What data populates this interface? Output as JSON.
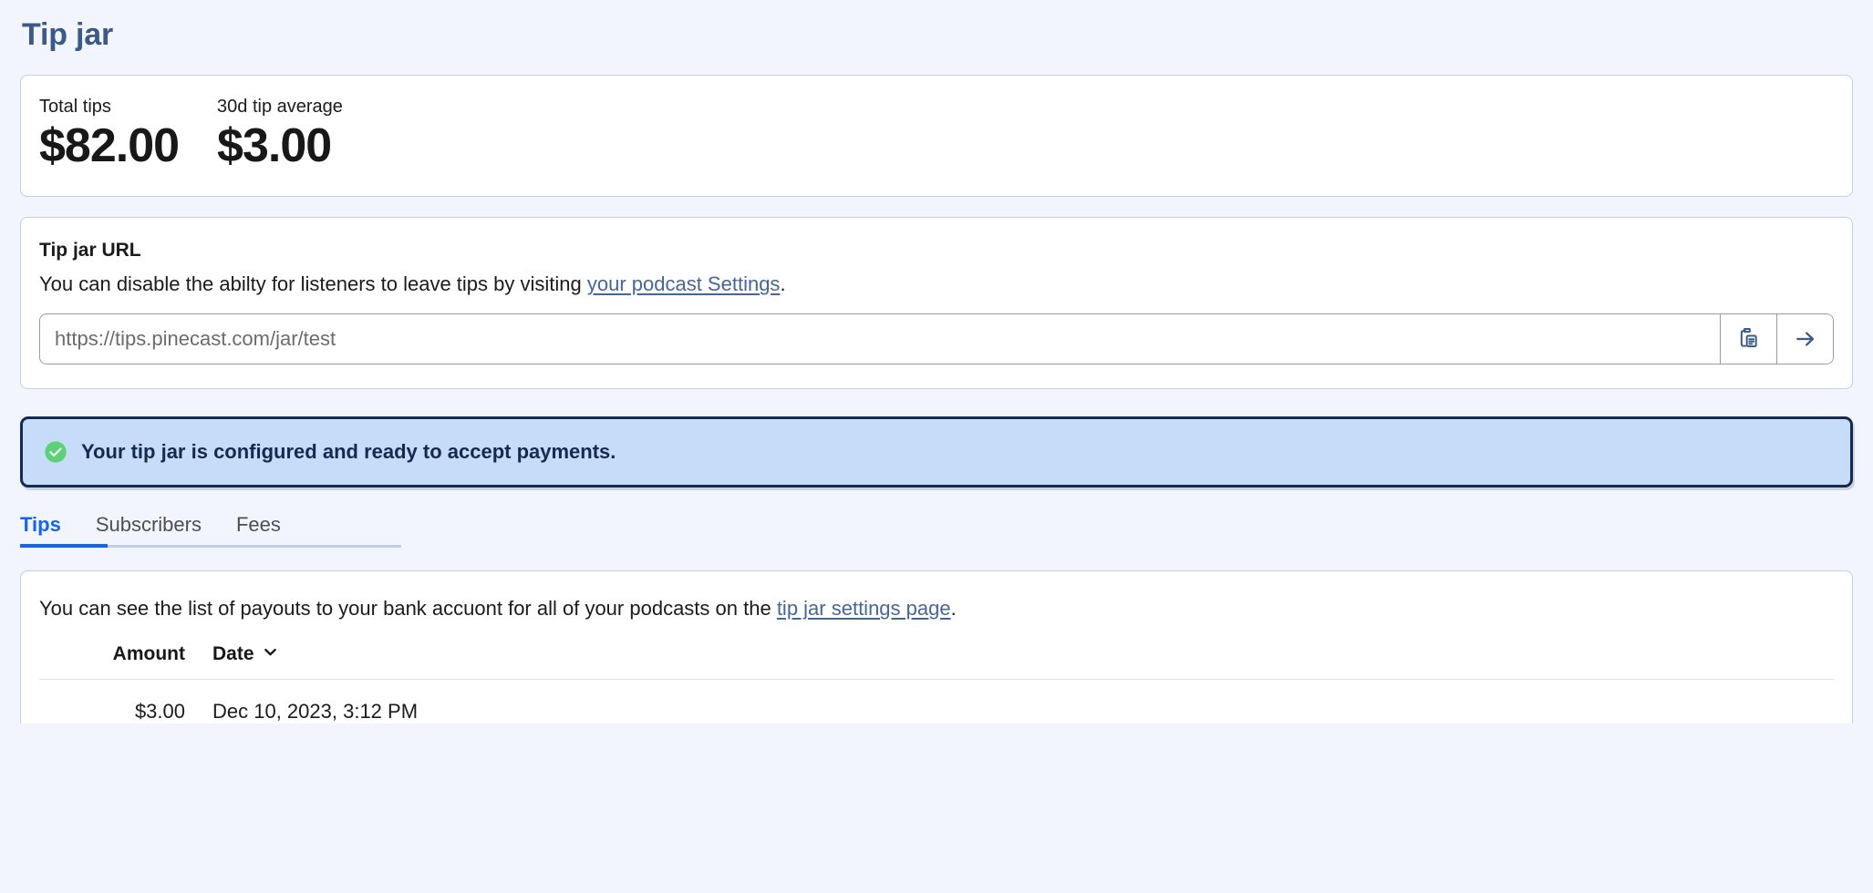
{
  "page": {
    "title": "Tip jar"
  },
  "stats": {
    "items": [
      {
        "label": "Total tips",
        "value": "$82.00"
      },
      {
        "label": "30d tip average",
        "value": "$3.00"
      }
    ]
  },
  "url_card": {
    "title": "Tip jar URL",
    "desc_before": "You can disable the abilty for listeners to leave tips by visiting ",
    "desc_link": "your podcast Settings",
    "desc_after": ".",
    "input_value": "https://tips.pinecast.com/jar/test",
    "input_placeholder": "https://tips.pinecast.com/jar/test",
    "copy_icon": "clipboard-copy-icon",
    "go_icon": "arrow-right-icon"
  },
  "banner": {
    "icon": "check-circle-icon",
    "text": "Your tip jar is configured and ready to accept payments.",
    "bg_color": "#c7dcf8",
    "border_color": "#122a54",
    "icon_color": "#5ed07a"
  },
  "tabs": {
    "items": [
      {
        "label": "Tips",
        "active": true
      },
      {
        "label": "Subscribers",
        "active": false
      },
      {
        "label": "Fees",
        "active": false
      }
    ],
    "active_color": "#1464ef"
  },
  "payouts": {
    "desc_before": "You can see the list of payouts to your bank accuont for all of your podcasts on the ",
    "desc_link": "tip jar settings page",
    "desc_after": ".",
    "columns": [
      {
        "key": "amount",
        "label": "Amount"
      },
      {
        "key": "date",
        "label": "Date",
        "sort_icon": "chevron-down-icon"
      }
    ],
    "rows": [
      {
        "amount": "$3.00",
        "date": "Dec 10, 2023, 3:12 PM"
      }
    ]
  }
}
